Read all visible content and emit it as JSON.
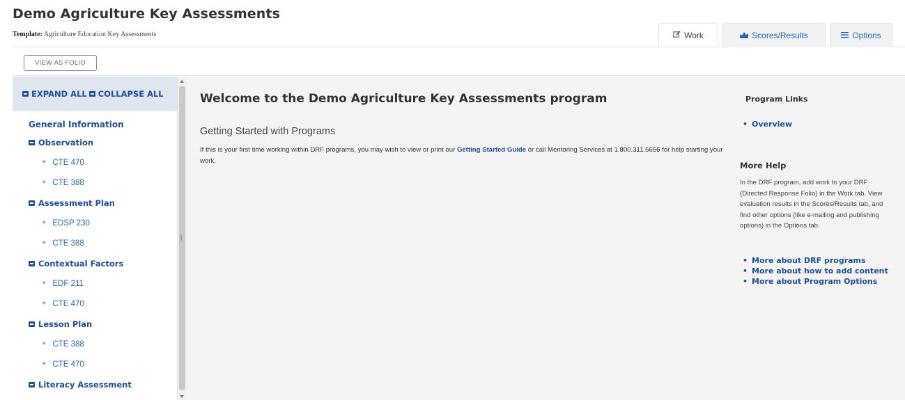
{
  "header": {
    "title": "Demo Agriculture Key Assessments",
    "template_label": "Template:",
    "template_value": "Agriculture Education Key Assessments"
  },
  "tabs": [
    {
      "label": "Work",
      "icon": "edit-icon",
      "active": true
    },
    {
      "label": "Scores/Results",
      "icon": "chart-icon",
      "active": false
    },
    {
      "label": "Options",
      "icon": "menu-icon",
      "active": false
    }
  ],
  "toolbar": {
    "view_as_folio": "VIEW AS FOLIO"
  },
  "sidebar": {
    "expand_all": "EXPAND ALL",
    "collapse_all": "COLLAPSE ALL",
    "root": "General Information",
    "sections": [
      {
        "title": "Observation",
        "items": [
          "CTE 470",
          "CTE 388"
        ]
      },
      {
        "title": "Assessment Plan",
        "items": [
          "EDSP 230",
          "CTE 388"
        ]
      },
      {
        "title": "Contextual Factors",
        "items": [
          "EDF 211",
          "CTE 470"
        ]
      },
      {
        "title": "Lesson Plan",
        "items": [
          "CTE 388",
          "CTE 470"
        ]
      },
      {
        "title": "Literacy Assessment",
        "items": []
      }
    ]
  },
  "main": {
    "welcome": "Welcome to the Demo Agriculture Key Assessments program",
    "subheading": "Getting Started with Programs",
    "intro_part1": "If this is your first time working within DRF programs, you may wish to view or print our",
    "intro_link": "Getting Started Guide",
    "intro_part2": "or call Mentoring Services at 1.800.311.5656 for help starting your work."
  },
  "right_panel": {
    "program_links_title": "Program Links",
    "overview_link": "Overview",
    "more_help_title": "More Help",
    "more_help_text": "In the DRF program, add work to your DRF (Directed Response Folio) in the Work tab. View evaluation results in the Scores/Results tab, and find other options (like e-mailing and publishing options) in the Options tab.",
    "help_links": [
      "More about DRF programs",
      "More about how to add content",
      "More about Program Options"
    ]
  },
  "colors": {
    "link": "#1f4f96",
    "sidebar_header_bg": "#dfe6f0",
    "main_bg": "#f4f4f5"
  }
}
